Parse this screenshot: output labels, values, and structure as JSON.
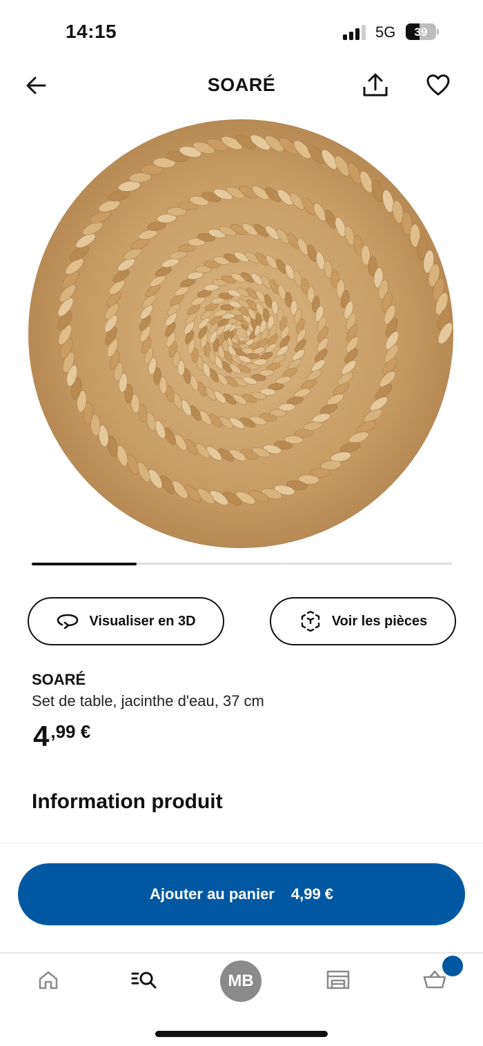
{
  "status_bar": {
    "time": "14:15",
    "network": "5G",
    "battery": "39",
    "icons": [
      "signal-icon",
      "battery-icon"
    ]
  },
  "header": {
    "title": "SOARÉ",
    "icons": [
      "back-arrow-icon",
      "share-icon",
      "heart-icon"
    ]
  },
  "product": {
    "image_label": "woven water hyacinth round place mat",
    "gallery_progress": 0.25,
    "name": "SOARÉ",
    "description": "Set de table, jacinthe d'eau, 37 cm",
    "price_int": "4",
    "price_dec": ",99 €"
  },
  "actions": {
    "visualize_3d": "Visualiser en 3D",
    "view_parts": "Voir les pièces"
  },
  "sections": {
    "info_title": "Information produit"
  },
  "cart_button": {
    "label": "Ajouter au panier",
    "price": "4,99 €"
  },
  "bottom_nav": {
    "profile_initials": "MB",
    "items": [
      "home-icon",
      "search-icon",
      "profile-avatar",
      "store-icon",
      "cart-icon"
    ]
  },
  "colors": {
    "primary": "#0058a3",
    "text": "#111111",
    "muted": "#8a8a8a",
    "mat": "#c9a06a"
  }
}
